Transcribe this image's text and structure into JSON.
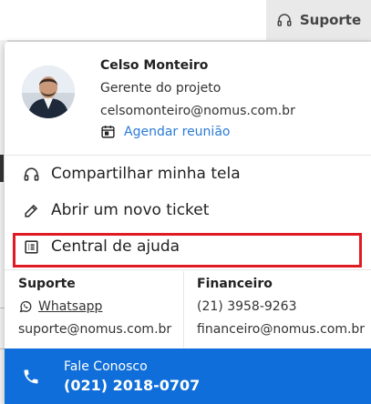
{
  "header": {
    "support_label": "Suporte"
  },
  "contact": {
    "name": "Celso Monteiro",
    "role": "Gerente do projeto",
    "email": "celsomonteiro@nomus.com.br",
    "schedule_label": "Agendar reunião"
  },
  "menu": {
    "items": [
      {
        "label": "Compartilhar minha tela",
        "icon": "headset-icon"
      },
      {
        "label": "Abrir um novo ticket",
        "icon": "pencil-icon"
      },
      {
        "label": "Central de ajuda",
        "icon": "list-document-icon"
      }
    ]
  },
  "info": {
    "support": {
      "title": "Suporte",
      "whatsapp_label": "Whatsapp",
      "email": "suporte@nomus.com.br"
    },
    "finance": {
      "title": "Financeiro",
      "phone": "(21) 3958-9263",
      "email": "financeiro@nomus.com.br"
    }
  },
  "footer": {
    "label": "Fale Conosco",
    "phone": "(021) 2018-0707"
  },
  "colors": {
    "accent": "#0f6ed9",
    "link": "#2a7bd6",
    "highlight": "#e01a22"
  }
}
